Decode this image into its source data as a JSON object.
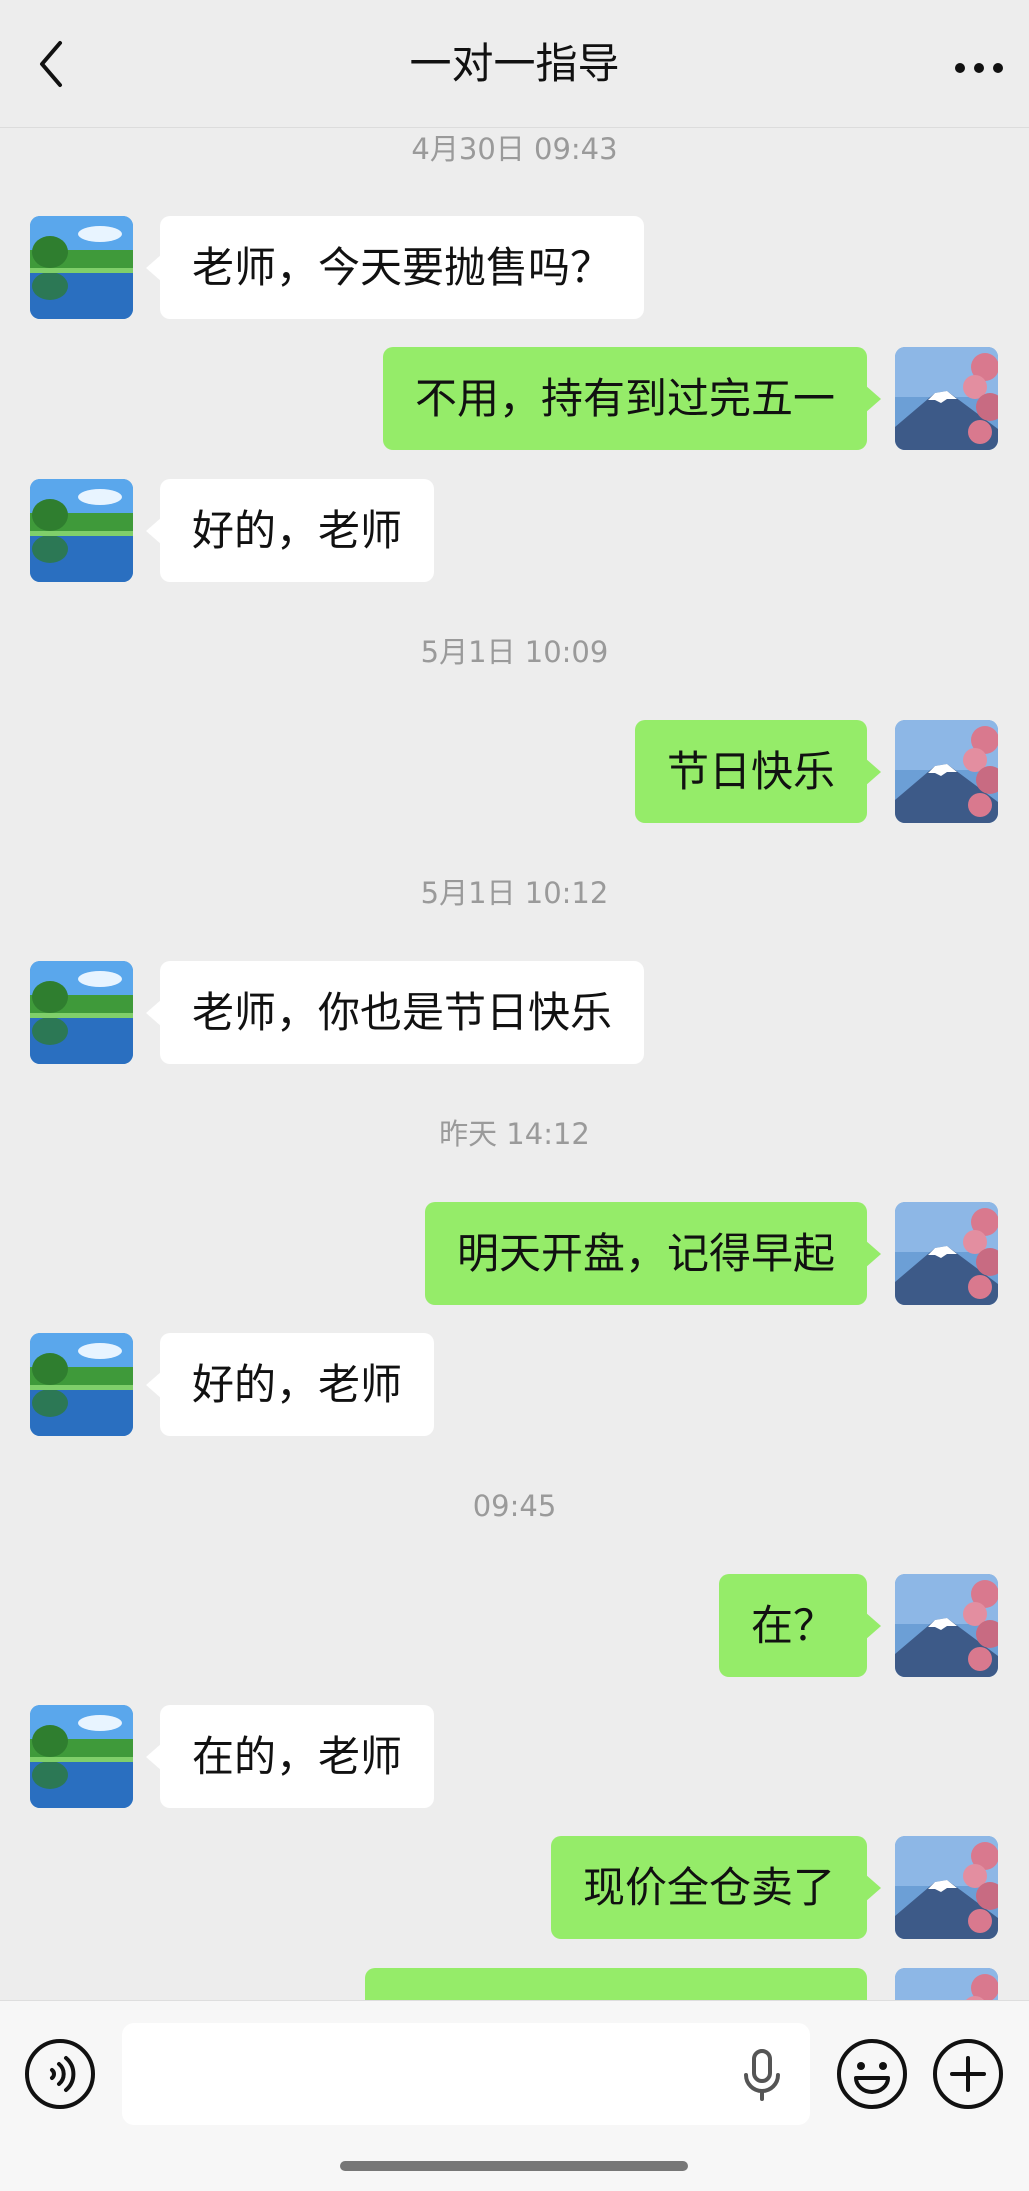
{
  "header": {
    "title": "一对一指导",
    "back_icon": "chevron-left-icon",
    "more_icon": "more-dots-icon"
  },
  "messages": [
    {
      "type": "timestamp",
      "text": "4月30日 09:43"
    },
    {
      "type": "msg",
      "side": "left",
      "text": "老师，今天要抛售吗？"
    },
    {
      "type": "msg",
      "side": "right",
      "text": "不用，持有到过完五一"
    },
    {
      "type": "msg",
      "side": "left",
      "text": "好的，老师"
    },
    {
      "type": "timestamp",
      "text": "5月1日 10:09"
    },
    {
      "type": "msg",
      "side": "right",
      "text": "节日快乐"
    },
    {
      "type": "timestamp",
      "text": "5月1日 10:12"
    },
    {
      "type": "msg",
      "side": "left",
      "text": "老师，你也是节日快乐"
    },
    {
      "type": "timestamp",
      "text": "昨天 14:12"
    },
    {
      "type": "msg",
      "side": "right",
      "text": "明天开盘，记得早起"
    },
    {
      "type": "msg",
      "side": "left",
      "text": "好的，老师"
    },
    {
      "type": "timestamp",
      "text": "09:45"
    },
    {
      "type": "msg",
      "side": "right",
      "text": "在？"
    },
    {
      "type": "msg",
      "side": "left",
      "text": "在的，老师"
    },
    {
      "type": "msg",
      "side": "right",
      "text": "现价全仓卖了"
    },
    {
      "type": "msg",
      "side": "right",
      "text": ""
    }
  ],
  "footer": {
    "voice_icon": "voice-icon",
    "mic_icon": "microphone-icon",
    "emoji_icon": "emoji-icon",
    "plus_icon": "plus-icon",
    "input_value": ""
  },
  "colors": {
    "background": "#ededed",
    "bubble_sent": "#95ec69",
    "bubble_received": "#ffffff",
    "timestamp": "#9a9a9a"
  }
}
